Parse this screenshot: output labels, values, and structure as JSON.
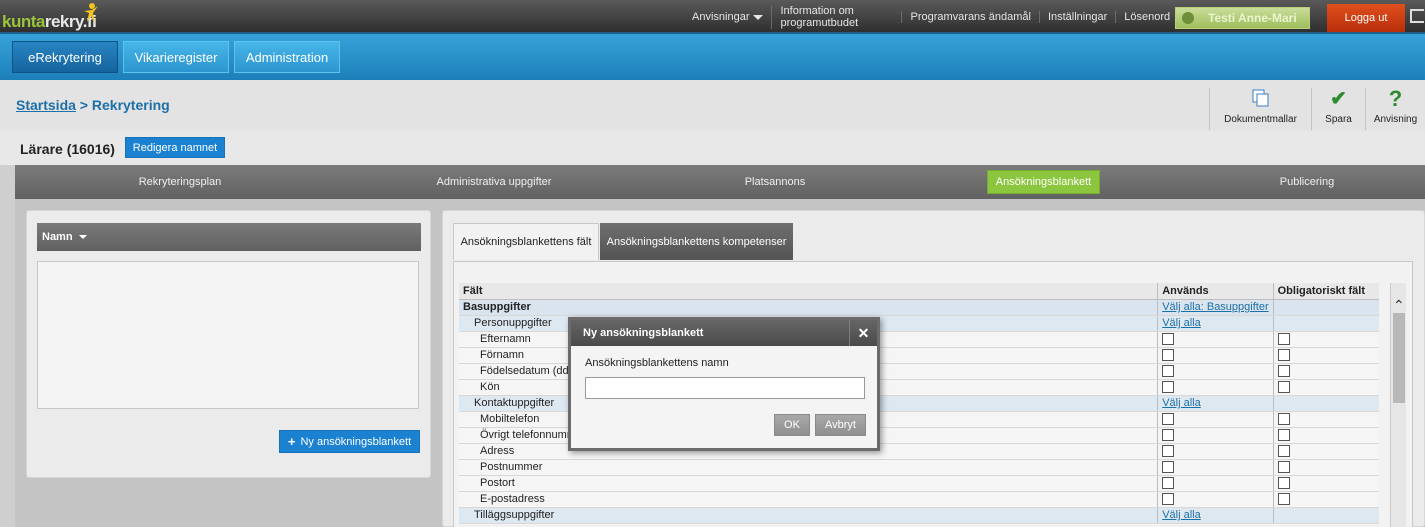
{
  "topbar": {
    "logo": "kuntarekry.fi",
    "links": [
      "Anvisningar",
      "Information om programutbudet",
      "Programvarans ändamål",
      "Inställningar",
      "Lösenord"
    ],
    "user": "Testi Anne-Mari",
    "logout": "Logga ut"
  },
  "nav": {
    "tabs": [
      "eRekrytering",
      "Vikarieregister",
      "Administration"
    ]
  },
  "breadcrumb": {
    "home": "Startsida",
    "sep": " > ",
    "current": "Rekrytering"
  },
  "tools": {
    "templates": "Dokumentmallar",
    "save": "Spara",
    "help": "Anvisning"
  },
  "page": {
    "title": "Lärare (16016)",
    "rename_button": "Redigera namnet"
  },
  "steps": [
    "Rekryteringsplan",
    "Administrativa uppgifter",
    "Platsannons",
    "Ansökningsblankett",
    "Publicering"
  ],
  "left_panel": {
    "name_header": "Namn",
    "new_button": "Ny ansökningsblankett"
  },
  "form_tabs": [
    "Ansökningsblankettens fält",
    "Ansökningsblankettens kompetenser"
  ],
  "table": {
    "headers": [
      "Fält",
      "Används",
      "Obligatoriskt fält"
    ],
    "rows": [
      {
        "type": "group",
        "label": "Basuppgifter",
        "link": "Välj alla: Basuppgifter"
      },
      {
        "type": "sub",
        "label": "Personuppgifter",
        "link": "Välj alla"
      },
      {
        "type": "item",
        "label": "Efternamn"
      },
      {
        "type": "item",
        "label": "Förnamn"
      },
      {
        "type": "item",
        "label": "Födelsedatum (dd"
      },
      {
        "type": "item",
        "label": "Kön"
      },
      {
        "type": "sub",
        "label": "Kontaktuppgifter",
        "link": "Välj alla"
      },
      {
        "type": "item",
        "label": "Mobiltelefon"
      },
      {
        "type": "item",
        "label": "Övrigt telefonnumm"
      },
      {
        "type": "item",
        "label": "Adress"
      },
      {
        "type": "item",
        "label": "Postnummer"
      },
      {
        "type": "item",
        "label": "Postort"
      },
      {
        "type": "item",
        "label": "E-postadress"
      },
      {
        "type": "sub",
        "label": "Tilläggsuppgifter",
        "link": "Välj alla"
      }
    ]
  },
  "modal": {
    "title": "Ny ansökningsblankett",
    "label": "Ansökningsblankettens namn",
    "input_value": "",
    "ok": "OK",
    "cancel": "Avbryt"
  }
}
